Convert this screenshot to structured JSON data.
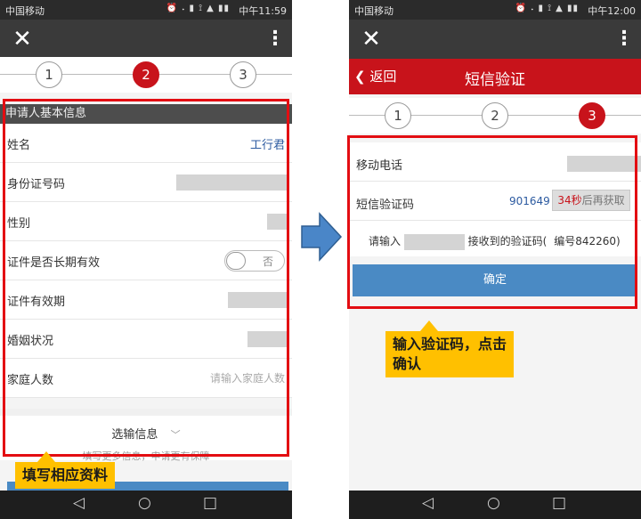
{
  "left_phone": {
    "status": {
      "carrier": "中国移动",
      "icons": "⏰ 𝆺 ▮ ⟟ ▲ ▮▮",
      "time": "中午11:59"
    },
    "steps": [
      "1",
      "2",
      "3"
    ],
    "section_title": "申请人基本信息",
    "fields": [
      {
        "label": "姓名",
        "value": "工行君"
      },
      {
        "label": "身份证号码",
        "value": ""
      },
      {
        "label": "性别",
        "value": ""
      },
      {
        "label": "证件是否长期有效",
        "toggle": "否"
      },
      {
        "label": "证件有效期",
        "value": ""
      },
      {
        "label": "婚姻状况",
        "value": ""
      },
      {
        "label": "家庭人数",
        "placeholder": "请输入家庭人数"
      }
    ],
    "optional_title": "选输信息",
    "optional_sub": "填写更多信息，申请更有保障",
    "callout": "填写相应资料"
  },
  "right_phone": {
    "status": {
      "carrier": "中国移动",
      "icons": "⏰ 𝆺 ▮ ⟟ ▲ ▮▮",
      "time": "中午12:00"
    },
    "back_label": "返回",
    "title": "短信验证",
    "steps": [
      "1",
      "2",
      "3"
    ],
    "mobile_label": "移动电话",
    "sms_label": "短信验证码",
    "sms_code": "901649",
    "resend_seconds": "34秒",
    "resend_text": "后再获取",
    "hint_prefix": "请输入",
    "hint_suffix": "接收到的验证码(",
    "hint_serial": "编号842260)",
    "confirm_label": "确定",
    "callout_line1": "输入验证码，点击",
    "callout_line2": "确认"
  },
  "nav": {
    "back": "◁",
    "home": "○",
    "recent": "□"
  },
  "colors": {
    "brand_red": "#c8131b",
    "highlight_red": "#e30d12",
    "callout_yellow": "#ffc000",
    "button_blue": "#4a8ac4"
  }
}
